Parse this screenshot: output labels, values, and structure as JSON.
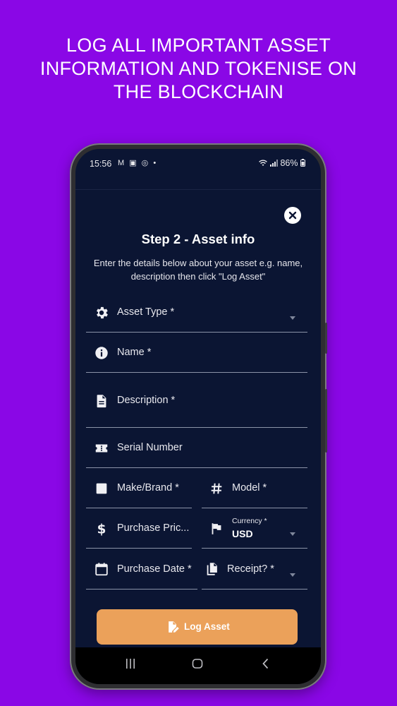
{
  "headline": "LOG ALL IMPORTANT ASSET\nINFORMATION AND TOKENISE ON\nTHE BLOCKCHAIN",
  "status_bar": {
    "time": "15:56",
    "notification_icons": "M ▣ ◎ •",
    "battery": "86%"
  },
  "form": {
    "title": "Step 2 - Asset info",
    "subtitle": "Enter the details below about your asset e.g. name, description then click \"Log Asset\"",
    "fields": {
      "asset_type": "Asset Type *",
      "name": "Name *",
      "description": "Description *",
      "serial_number": "Serial Number",
      "make_brand": "Make/Brand *",
      "model": "Model *",
      "purchase_price": "Purchase Pric...",
      "currency_label": "Currency *",
      "currency_value": "USD",
      "purchase_date": "Purchase Date *",
      "receipt": "Receipt? *"
    },
    "submit_label": "Log Asset"
  },
  "colors": {
    "background": "#8a07e6",
    "screen": "#0b1533",
    "accent_button": "#eba15a"
  },
  "icons": [
    "close-icon",
    "gear-icon",
    "info-icon",
    "document-icon",
    "ticket-icon",
    "square-icon",
    "hash-icon",
    "dollar-icon",
    "flag-icon",
    "calendar-icon",
    "copy-icon",
    "edit-document-icon",
    "recents-icon",
    "home-icon",
    "back-icon"
  ]
}
